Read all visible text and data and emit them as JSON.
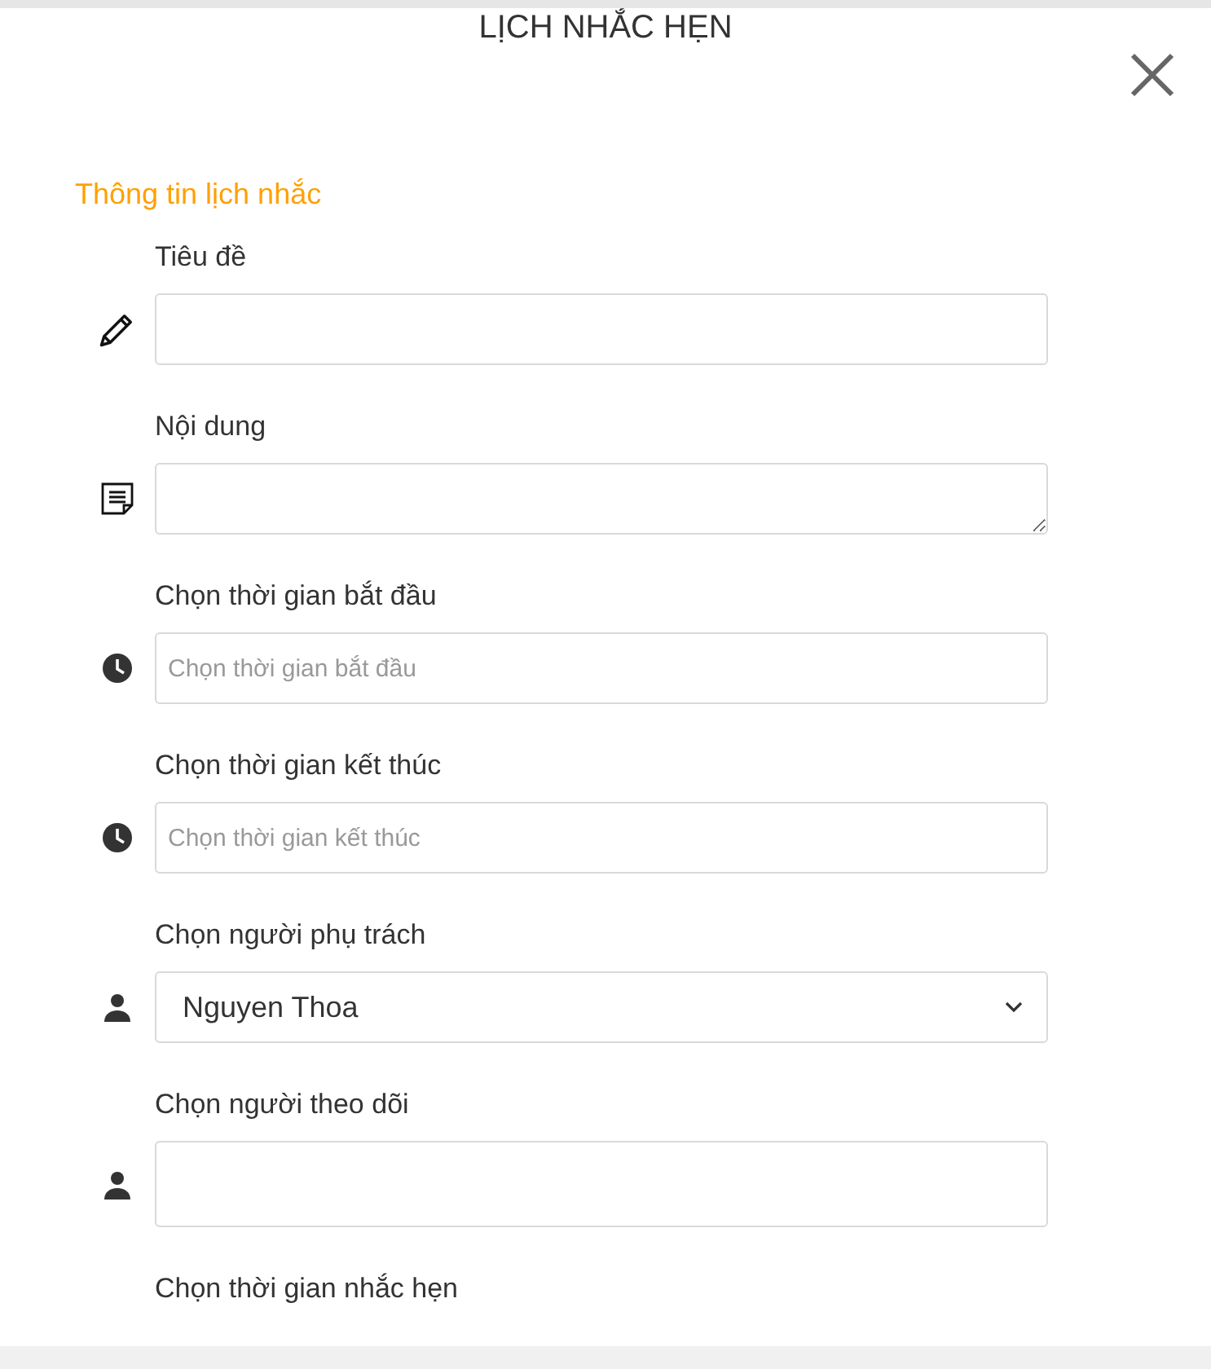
{
  "dialog": {
    "title": "LỊCH NHẮC HẸN"
  },
  "section": {
    "title": "Thông tin lịch nhắc"
  },
  "fields": [
    {
      "label": "Tiêu đề",
      "kind": "text"
    },
    {
      "label": "Nội dung",
      "kind": "textarea"
    },
    {
      "label": "Chọn thời gian bắt đầu",
      "kind": "text",
      "placeholder": "Chọn thời gian bắt đầu"
    },
    {
      "label": "Chọn thời gian kết thúc",
      "kind": "text",
      "placeholder": "Chọn thời gian kết thúc"
    },
    {
      "label": "Chọn người phụ trách",
      "kind": "select",
      "value": "Nguyen Thoa"
    },
    {
      "label": "Chọn người theo dõi",
      "kind": "tags"
    },
    {
      "label": "Chọn thời gian nhắc hẹn",
      "kind": "label"
    }
  ]
}
